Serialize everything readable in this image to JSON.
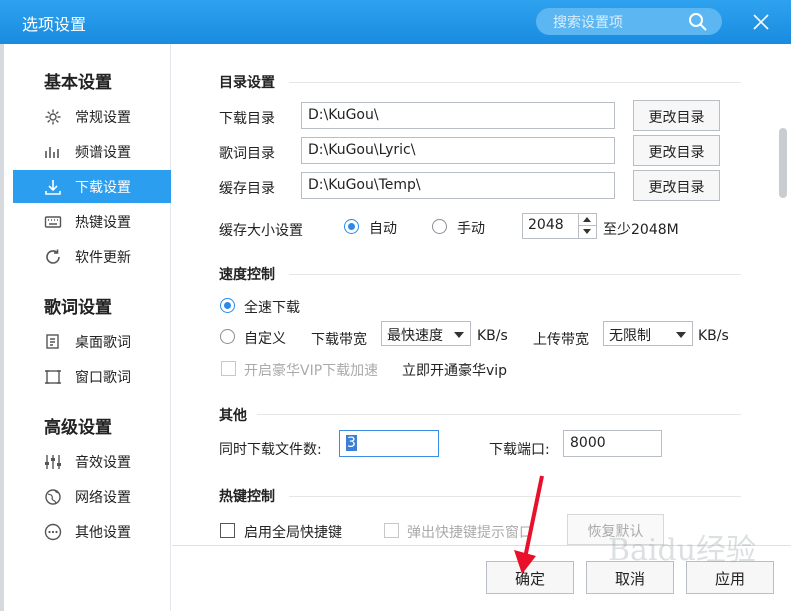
{
  "window": {
    "title": "选项设置",
    "search_placeholder": "搜索设置项"
  },
  "sidebar": {
    "sections": [
      {
        "title": "基本设置",
        "items": [
          {
            "label": "常规设置",
            "icon": "gear-icon"
          },
          {
            "label": "频谱设置",
            "icon": "spectrum-icon"
          },
          {
            "label": "下载设置",
            "icon": "download-icon",
            "active": true
          },
          {
            "label": "热键设置",
            "icon": "keyboard-icon"
          },
          {
            "label": "软件更新",
            "icon": "refresh-icon"
          }
        ]
      },
      {
        "title": "歌词设置",
        "items": [
          {
            "label": "桌面歌词",
            "icon": "desktop-lyric-icon"
          },
          {
            "label": "窗口歌词",
            "icon": "window-lyric-icon"
          }
        ]
      },
      {
        "title": "高级设置",
        "items": [
          {
            "label": "音效设置",
            "icon": "equalizer-icon"
          },
          {
            "label": "网络设置",
            "icon": "globe-icon"
          },
          {
            "label": "其他设置",
            "icon": "more-icon"
          }
        ]
      }
    ]
  },
  "directory": {
    "title": "目录设置",
    "download_label": "下载目录",
    "download_value": "D:\\KuGou\\",
    "lyric_label": "歌词目录",
    "lyric_value": "D:\\KuGou\\Lyric\\",
    "cache_label": "缓存目录",
    "cache_value": "D:\\KuGou\\Temp\\",
    "change_button": "更改目录",
    "cache_size_label": "缓存大小设置",
    "auto_label": "自动",
    "manual_label": "手动",
    "cache_size_value": "2048",
    "cache_hint": "至少2048M"
  },
  "speed": {
    "title": "速度控制",
    "full_speed_label": "全速下载",
    "custom_label": "自定义",
    "download_bw_label": "下载带宽",
    "download_bw_value": "最快速度",
    "download_unit": "KB/s",
    "upload_bw_label": "上传带宽",
    "upload_bw_value": "无限制",
    "upload_unit": "KB/s",
    "vip_label": "开启豪华VIP下载加速",
    "vip_link": "立即开通豪华vip"
  },
  "other": {
    "title": "其他",
    "concurrent_label": "同时下载文件数:",
    "concurrent_value": "3",
    "port_label": "下载端口:",
    "port_value": "8000"
  },
  "hotkey": {
    "title": "热键控制",
    "global_label": "启用全局快捷键",
    "popup_label": "弹出快捷键提示窗口",
    "restore_button": "恢复默认"
  },
  "footer": {
    "ok": "确定",
    "cancel": "取消",
    "apply": "应用"
  },
  "watermark": "Baidu经验",
  "colors": {
    "titlebar": "#1a8be0",
    "active": "#2b9ef0",
    "annotation_arrow": "#e8102a"
  }
}
